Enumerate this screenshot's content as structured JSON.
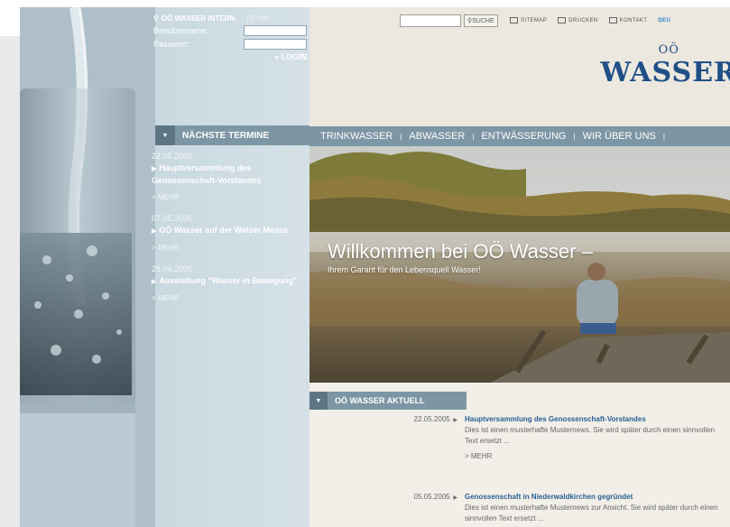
{
  "login": {
    "title": "OÖ WASSER INTERN",
    "help": "[?] Hilfe",
    "username_label": "Benutzername:",
    "password_label": "Passwort:",
    "login_button": "» LOGIN"
  },
  "search": {
    "button": "SUCHE"
  },
  "toplinks": {
    "sitemap": "SITEMAP",
    "print": "DRUCKEN",
    "contact": "KONTAKT",
    "lang": "DEU"
  },
  "logo": {
    "top": "OÖ",
    "main": "WASSER"
  },
  "nav": [
    "TRINKWASSER",
    "ABWASSER",
    "ENTWÄSSERUNG",
    "WIR ÜBER UNS"
  ],
  "hero": {
    "title": "Willkommen bei OÖ Wasser –",
    "subtitle": "Ihrem Garant für den Lebensquell Wasser!"
  },
  "events": {
    "header": "NÄCHSTE TERMINE",
    "items": [
      {
        "date": "22.05.2005",
        "title": "Hauptversammlung des Genossenschaft-Vorstandes",
        "more": "> MEHR"
      },
      {
        "date": "07.05.2005",
        "title": "OÖ Wasser auf der Welser Messe",
        "more": "> MEHR"
      },
      {
        "date": "28.04.2005",
        "title": "Ausstellung \"Wasser in Bewegung\"",
        "more": "> MEHR"
      }
    ]
  },
  "news": {
    "header": "OÖ WASSER AKTUELL",
    "items": [
      {
        "date": "22.05.2005",
        "title": "Hauptversammlung des Genossenschaft-Vorstandes",
        "text": "Dies ist einen musterhafte Musternews. Sie wird später durch einen sinnvollen Text ersetzt ...",
        "more": "> MEHR"
      },
      {
        "date": "05.05.2005",
        "title": "Genossenschaft in Niederwaldkirchen gegründet",
        "text": "Dies ist einen musterhafte Musternews zur Ansicht. Sie wird später durch einen sinnvollen Text ersetzt ..."
      }
    ]
  },
  "colors": {
    "nav": "#7d96a4",
    "panel": "#c9d8e0",
    "news_title": "#2a5f94",
    "logo": "#1f4f86"
  }
}
